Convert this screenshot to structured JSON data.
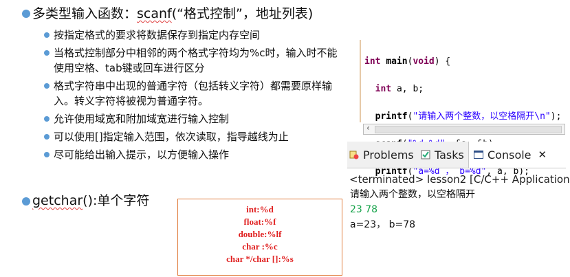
{
  "slide": {
    "heading1": "多类型输入函数：scanf(“格式控制”，地址列表)",
    "heading1_underlined": "scanf",
    "points": [
      "按指定格式的要求将数据保存到指定内存空间",
      "当格式控制部分中相邻的两个格式字符均为%c时，输入时不能使用空格、tab键或回车进行区分",
      "格式字符串中出现的普通字符（包括转义字符）都需要原样输入。转义字符将被视为普通字符。",
      "允许使用域宽和附加域宽进行输入控制",
      "可以使用[]指定输入范围，依次读取，指导越线为止",
      "尽可能给出输入提示，以方便输入操作"
    ],
    "heading2": "getchar():单个字符",
    "heading2_underlined": "getchar"
  },
  "code": {
    "lines": [
      "int main(void) {",
      "  int a, b;",
      "  printf(\"请输入两个整数，以空格隔开\\n\");",
      "  scanf(\"%d %d\", &a, &b);",
      "  printf(\"a=%d , b=%d\", a, b);"
    ]
  },
  "ide": {
    "tabs": [
      "Problems",
      "Tasks",
      "Console"
    ],
    "active_tab": "Console",
    "status": "<terminated> lesson2 [C/C++ Application]",
    "output": [
      {
        "text": "请输入两个整数，以空格隔开",
        "color": "#111111"
      },
      {
        "text": "23 78",
        "color": "#16a34a"
      },
      {
        "text": "a=23， b=78",
        "color": "#111111"
      }
    ]
  },
  "formats": [
    "int:%d",
    "float:%f",
    "double:%lf",
    "char :%c",
    "char */char []:%s"
  ],
  "colors": {
    "accent": "#5b9bd5",
    "red_text": "#e02020",
    "box_border": "#e07a3a"
  }
}
